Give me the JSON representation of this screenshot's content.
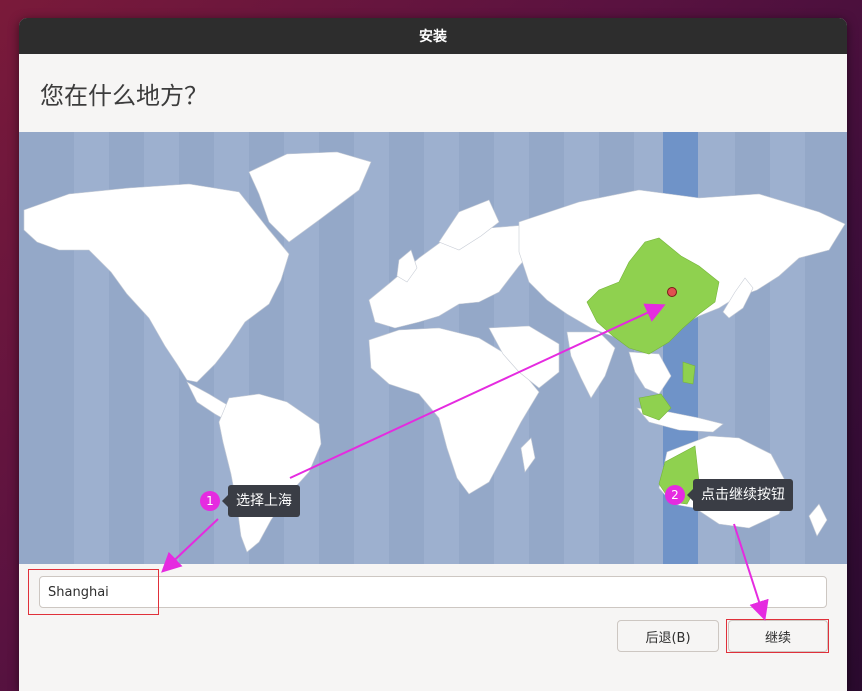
{
  "window": {
    "title": "安装"
  },
  "page": {
    "heading": "您在什么地方？"
  },
  "map": {
    "selected_city": "Shanghai",
    "highlight_color": "#8fd14f"
  },
  "location": {
    "value": "Shanghai",
    "placeholder": ""
  },
  "buttons": {
    "back": "后退(B)",
    "continue": "继续"
  },
  "annotations": {
    "step1": {
      "number": "1",
      "text": "选择上海"
    },
    "step2": {
      "number": "2",
      "text": "点击继续按钮"
    },
    "color": "#e52be0"
  },
  "icons": {
    "map_pin": "map-pin-icon"
  }
}
